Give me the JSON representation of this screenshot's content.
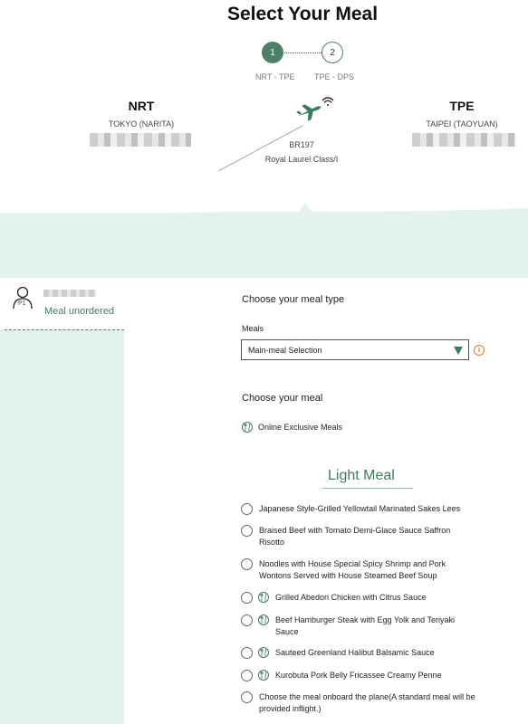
{
  "title": "Select Your Meal",
  "steps": [
    {
      "number": "1",
      "label": "NRT - TPE"
    },
    {
      "number": "2",
      "label": "TPE - DPS"
    }
  ],
  "origin": {
    "code": "NRT",
    "name": "TOKYO (NARITA)"
  },
  "destination": {
    "code": "TPE",
    "name": "TAIPEI (TAOYUAN)"
  },
  "flight": {
    "number": "BR197",
    "cabin": "Royal Laurel Class/I"
  },
  "passenger": {
    "tag": "P1",
    "status": "Meal unordered"
  },
  "meal_type": {
    "heading": "Choose your meal type",
    "field_label": "Meals",
    "selected": "Main-meal Selection"
  },
  "meal_choice": {
    "heading": "Choose your meal",
    "legend": "Online Exclusive Meals"
  },
  "light_meal": {
    "title": "Light Meal",
    "options": [
      {
        "line1": "Japanese Style-Grilled Yellowtail Marinated Sakes Lees",
        "line2": "",
        "exclusive": false
      },
      {
        "line1": "Braised Beef with Tomato Demi-Glace Sauce Saffron",
        "line2": "Risotto",
        "exclusive": false
      },
      {
        "line1": "Noodles with House Special Spicy Shrimp and Pork",
        "line2": "Wontons Served with House Steamed Beef Soup",
        "exclusive": false
      },
      {
        "line1": "Grilled Abedori Chicken with Citrus Sauce",
        "line2": "",
        "exclusive": true
      },
      {
        "line1": "Beef Hamburger Steak with Egg Yolk and Teriyaki",
        "line2": "Sauce",
        "exclusive": true
      },
      {
        "line1": "Sauteed Greenland Halibut Balsamic Sauce",
        "line2": "",
        "exclusive": true
      },
      {
        "line1": "Kurobuta Pork Belly Fricassee Creamy Penne",
        "line2": "",
        "exclusive": true
      },
      {
        "line1": "Choose the meal onboard the plane(A standard meal will be",
        "line2": "provided inflight.)",
        "exclusive": false
      }
    ]
  },
  "colors": {
    "accent": "#4e7f68",
    "band": "#e4f2ec",
    "info": "#e07b28"
  }
}
